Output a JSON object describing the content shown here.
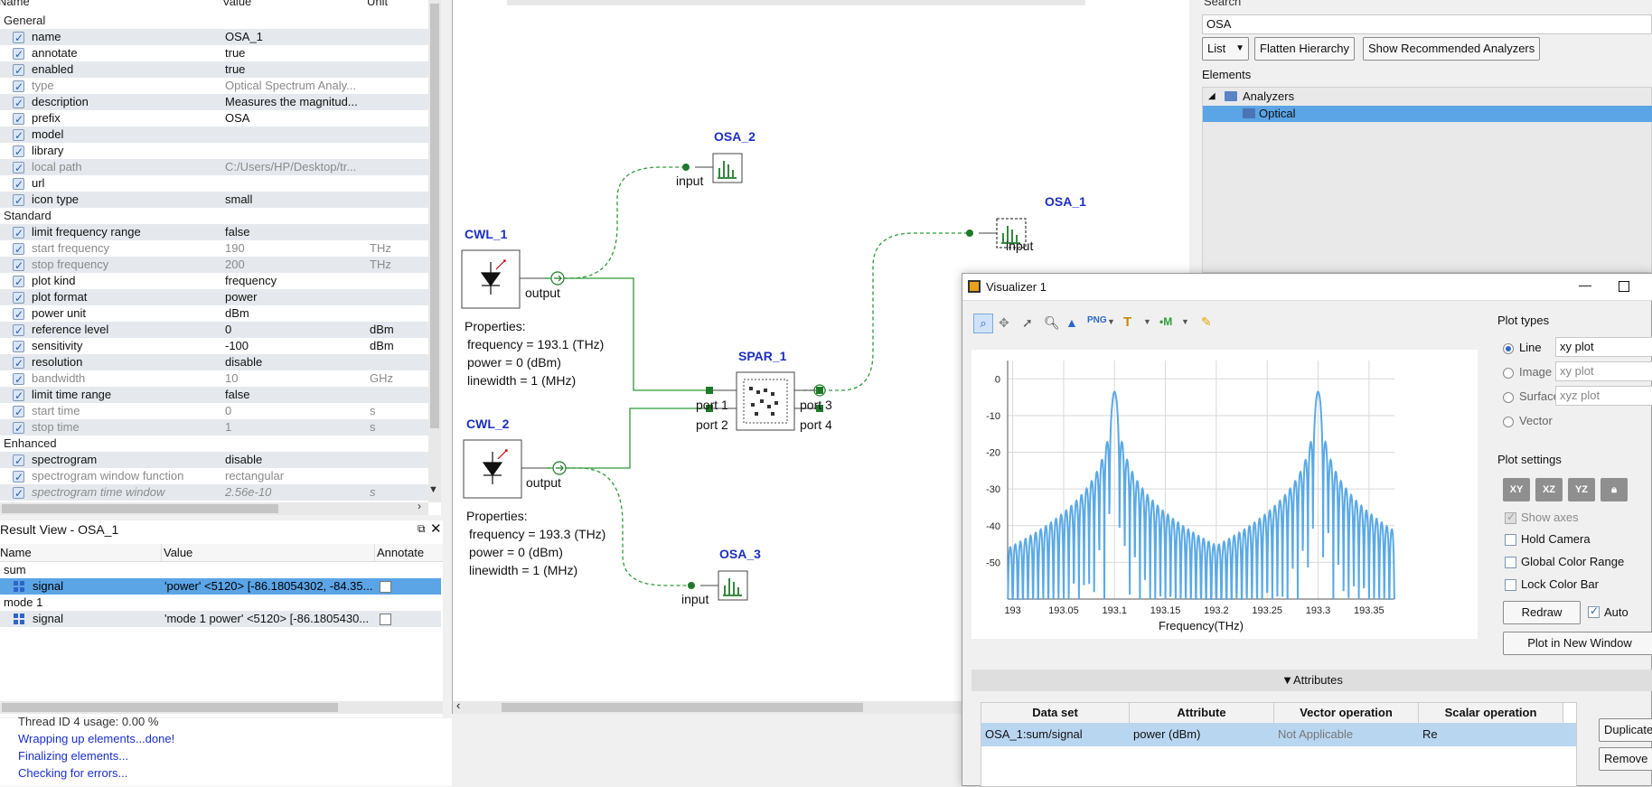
{
  "properties": {
    "headers": {
      "name": "Name",
      "value": "Value",
      "unit": "Unit"
    },
    "rows": [
      {
        "kind": "section",
        "name": "General"
      },
      {
        "name": "name",
        "value": "OSA_1",
        "unit": "",
        "checked": true,
        "dim": false
      },
      {
        "name": "annotate",
        "value": "true",
        "unit": "",
        "checked": true,
        "dim": false
      },
      {
        "name": "enabled",
        "value": "true",
        "unit": "",
        "checked": true,
        "dim": false
      },
      {
        "name": "type",
        "value": "Optical Spectrum Analy...",
        "unit": "",
        "checked": true,
        "dim": true
      },
      {
        "name": "description",
        "value": "Measures the magnitud...",
        "unit": "",
        "checked": true,
        "dim": false
      },
      {
        "name": "prefix",
        "value": "OSA",
        "unit": "",
        "checked": true,
        "dim": false
      },
      {
        "name": "model",
        "value": "",
        "unit": "",
        "checked": true,
        "dim": false
      },
      {
        "name": "library",
        "value": "",
        "unit": "",
        "checked": true,
        "dim": false
      },
      {
        "name": "local path",
        "value": "C:/Users/HP/Desktop/tr...",
        "unit": "",
        "checked": true,
        "dim": true
      },
      {
        "name": "url",
        "value": "",
        "unit": "",
        "checked": true,
        "dim": false
      },
      {
        "name": "icon type",
        "value": "small",
        "unit": "",
        "checked": true,
        "dim": false
      },
      {
        "kind": "section",
        "name": "Standard"
      },
      {
        "name": "limit frequency range",
        "value": "false",
        "unit": "",
        "checked": true,
        "dim": false
      },
      {
        "name": "start frequency",
        "value": "190",
        "unit": "THz",
        "checked": true,
        "dim": true
      },
      {
        "name": "stop frequency",
        "value": "200",
        "unit": "THz",
        "checked": true,
        "dim": true
      },
      {
        "name": "plot kind",
        "value": "frequency",
        "unit": "",
        "checked": true,
        "dim": false
      },
      {
        "name": "plot format",
        "value": "power",
        "unit": "",
        "checked": true,
        "dim": false
      },
      {
        "name": "power unit",
        "value": "dBm",
        "unit": "",
        "checked": true,
        "dim": false
      },
      {
        "name": "reference level",
        "value": "0",
        "unit": "dBm",
        "checked": true,
        "dim": false
      },
      {
        "name": "sensitivity",
        "value": "-100",
        "unit": "dBm",
        "checked": true,
        "dim": false
      },
      {
        "name": "resolution",
        "value": "disable",
        "unit": "",
        "checked": true,
        "dim": false
      },
      {
        "name": "bandwidth",
        "value": "10",
        "unit": "GHz",
        "checked": true,
        "dim": true
      },
      {
        "name": "limit time range",
        "value": "false",
        "unit": "",
        "checked": true,
        "dim": false
      },
      {
        "name": "start time",
        "value": "0",
        "unit": "s",
        "checked": true,
        "dim": true
      },
      {
        "name": "stop time",
        "value": "1",
        "unit": "s",
        "checked": true,
        "dim": true
      },
      {
        "kind": "section",
        "name": "Enhanced"
      },
      {
        "name": "spectrogram",
        "value": "disable",
        "unit": "",
        "checked": true,
        "dim": false
      },
      {
        "name": "spectrogram window function",
        "value": "rectangular",
        "unit": "",
        "checked": true,
        "dim": true
      },
      {
        "name": "spectrogram time window",
        "value": "2.56e-10",
        "unit": "s",
        "checked": true,
        "dim": true,
        "italic": true
      }
    ]
  },
  "result_view": {
    "title": "Result View - OSA_1",
    "headers": {
      "name": "Name",
      "value": "Value",
      "annotate": "Annotate"
    },
    "rows": [
      {
        "kind": "section",
        "name": "sum"
      },
      {
        "name": "signal",
        "value": "'power' <5120> [-86.18054302, -84.35...",
        "selected": true
      },
      {
        "kind": "section",
        "name": "mode 1"
      },
      {
        "name": "signal",
        "value": "'mode 1 power' <5120> [-86.1805430...",
        "selected": false
      }
    ]
  },
  "log": {
    "lines": [
      {
        "text": "Thread ID 4 usage: 0.00 %",
        "color": "#333333"
      },
      {
        "text": "Wrapping up elements...done!",
        "color": "#1a2fd0"
      },
      {
        "text": "Finalizing elements...",
        "color": "#1a2fd0"
      },
      {
        "text": "Checking for errors...",
        "color": "#1a2fd0"
      }
    ]
  },
  "schematic": {
    "elements": {
      "osa2": "OSA_2",
      "osa1": "OSA_1",
      "osa3": "OSA_3",
      "cwl1": "CWL_1",
      "cwl2": "CWL_2",
      "spar1": "SPAR_1"
    },
    "ports": {
      "input": "input",
      "output": "output",
      "port1": "port 1",
      "port2": "port 2",
      "port3": "port 3",
      "port4": "port 4"
    },
    "cwl1_props": [
      "Properties:",
      "frequency = 193.1 (THz)",
      "power = 0 (dBm)",
      "linewidth = 1 (MHz)"
    ],
    "cwl2_props": [
      "Properties:",
      "frequency = 193.3 (THz)",
      "power = 0 (dBm)",
      "linewidth = 1 (MHz)"
    ]
  },
  "elements_panel": {
    "search_label": "Search",
    "search_value": "OSA",
    "view_mode": "List",
    "flatten_button": "Flatten Hierarchy",
    "recommend_button": "Show Recommended Analyzers",
    "section_title": "Elements",
    "tree": [
      {
        "label": "Analyzers"
      },
      {
        "label": "Optical",
        "selected": true
      }
    ]
  },
  "visualizer": {
    "title": "Visualizer 1",
    "plot_types_title": "Plot types",
    "plot_types": [
      {
        "label": "Line",
        "value": "xy plot",
        "selected": true
      },
      {
        "label": "Image",
        "value": "xy plot",
        "selected": false
      },
      {
        "label": "Surface",
        "value": "xyz plot",
        "selected": false
      },
      {
        "label": "Vector",
        "value": "",
        "selected": false
      }
    ],
    "plot_settings_title": "Plot settings",
    "view_buttons": [
      "XY",
      "XZ",
      "YZ",
      "lock"
    ],
    "settings": {
      "show_axes": "Show axes",
      "hold_camera": "Hold Camera",
      "global_color_range": "Global Color Range",
      "lock_color_bar": "Lock Color Bar"
    },
    "redraw": "Redraw",
    "auto": "Auto",
    "plot_new_window": "Plot in New Window",
    "attributes_title": "Attributes",
    "table_headers": [
      "Data set",
      "Attribute",
      "Vector operation",
      "Scalar operation"
    ],
    "table_row": [
      "OSA_1:sum/signal",
      "power (dBm)",
      "Not Applicable",
      "Re"
    ],
    "duplicate": "Duplicate",
    "remove": "Remove",
    "plot_color": "#5aa9e6"
  },
  "chart_data": {
    "type": "line",
    "title": "",
    "xlabel": "Frequency(THz)",
    "ylabel": "",
    "xlim": [
      192.995,
      193.375
    ],
    "ylim": [
      -60,
      5
    ],
    "xticks": [
      193,
      193.05,
      193.1,
      193.15,
      193.2,
      193.25,
      193.3,
      193.35
    ],
    "yticks": [
      0,
      -10,
      -20,
      -30,
      -40,
      -50
    ],
    "series": [
      {
        "peaks": [
          {
            "center": 193.1,
            "peak": -3.5
          },
          {
            "center": 193.3,
            "peak": -3.5
          }
        ],
        "sidelobe_spacing_thz": 0.005,
        "floor": -60
      }
    ]
  }
}
